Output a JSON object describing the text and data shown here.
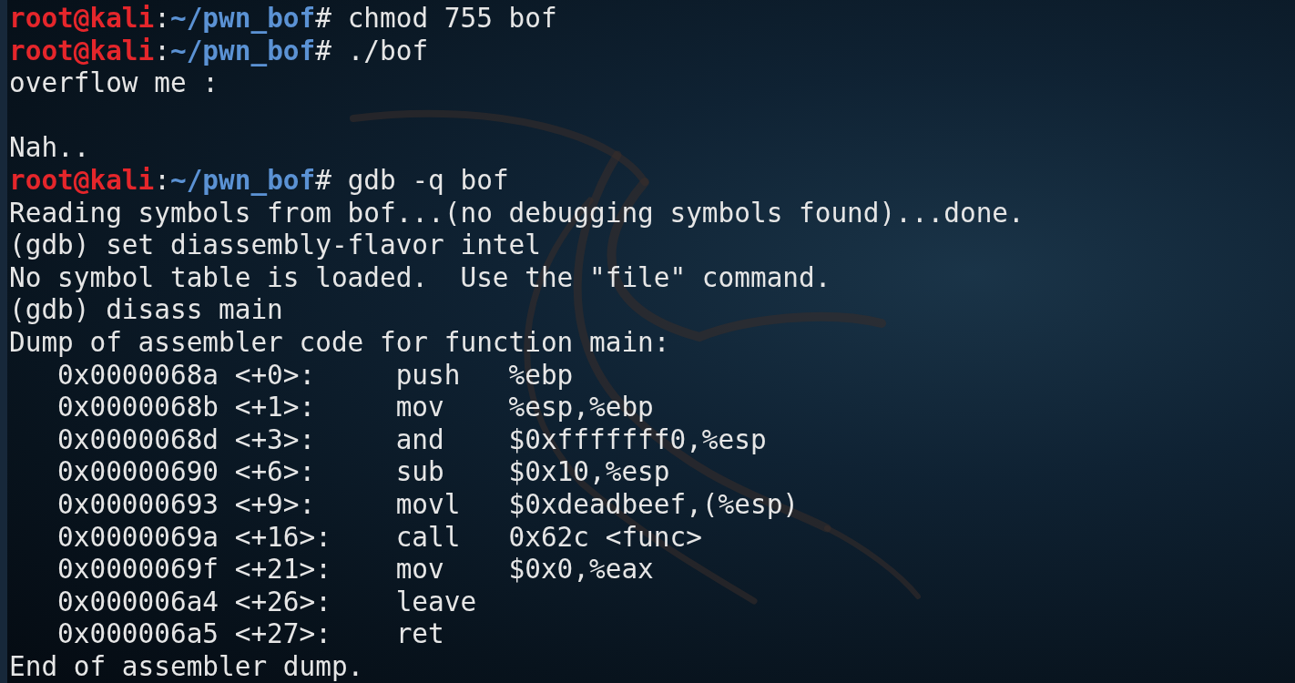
{
  "terminal": {
    "lines": [
      {
        "kind": "prompt",
        "user_host": "root@kali",
        "separator": ":",
        "path": "~/pwn_bof",
        "symbol": "#",
        "command": "chmod 755 bof"
      },
      {
        "kind": "prompt",
        "user_host": "root@kali",
        "separator": ":",
        "path": "~/pwn_bof",
        "symbol": "#",
        "command": "./bof"
      },
      {
        "kind": "text",
        "text": "overflow me :"
      },
      {
        "kind": "blank"
      },
      {
        "kind": "text",
        "text": "Nah.."
      },
      {
        "kind": "prompt",
        "user_host": "root@kali",
        "separator": ":",
        "path": "~/pwn_bof",
        "symbol": "#",
        "command": "gdb -q bof"
      },
      {
        "kind": "text",
        "text": "Reading symbols from bof...(no debugging symbols found)...done."
      },
      {
        "kind": "text",
        "text": "(gdb) set diassembly-flavor intel"
      },
      {
        "kind": "text",
        "text": "No symbol table is loaded.  Use the \"file\" command."
      },
      {
        "kind": "text",
        "text": "(gdb) disass main"
      },
      {
        "kind": "text",
        "text": "Dump of assembler code for function main:"
      },
      {
        "kind": "asm",
        "address": "0x0000068a",
        "offset": "<+0>:",
        "mnemonic": "push",
        "operands": "%ebp"
      },
      {
        "kind": "asm",
        "address": "0x0000068b",
        "offset": "<+1>:",
        "mnemonic": "mov",
        "operands": "%esp,%ebp"
      },
      {
        "kind": "asm",
        "address": "0x0000068d",
        "offset": "<+3>:",
        "mnemonic": "and",
        "operands": "$0xfffffff0,%esp"
      },
      {
        "kind": "asm",
        "address": "0x00000690",
        "offset": "<+6>:",
        "mnemonic": "sub",
        "operands": "$0x10,%esp"
      },
      {
        "kind": "asm",
        "address": "0x00000693",
        "offset": "<+9>:",
        "mnemonic": "movl",
        "operands": "$0xdeadbeef,(%esp)"
      },
      {
        "kind": "asm",
        "address": "0x0000069a",
        "offset": "<+16>:",
        "mnemonic": "call",
        "operands": "0x62c <func>"
      },
      {
        "kind": "asm",
        "address": "0x0000069f",
        "offset": "<+21>:",
        "mnemonic": "mov",
        "operands": "$0x0,%eax"
      },
      {
        "kind": "asm",
        "address": "0x000006a4",
        "offset": "<+26>:",
        "mnemonic": "leave"
      },
      {
        "kind": "asm",
        "address": "0x000006a5",
        "offset": "<+27>:",
        "mnemonic": "ret"
      },
      {
        "kind": "text",
        "text": "End of assembler dump."
      }
    ]
  }
}
